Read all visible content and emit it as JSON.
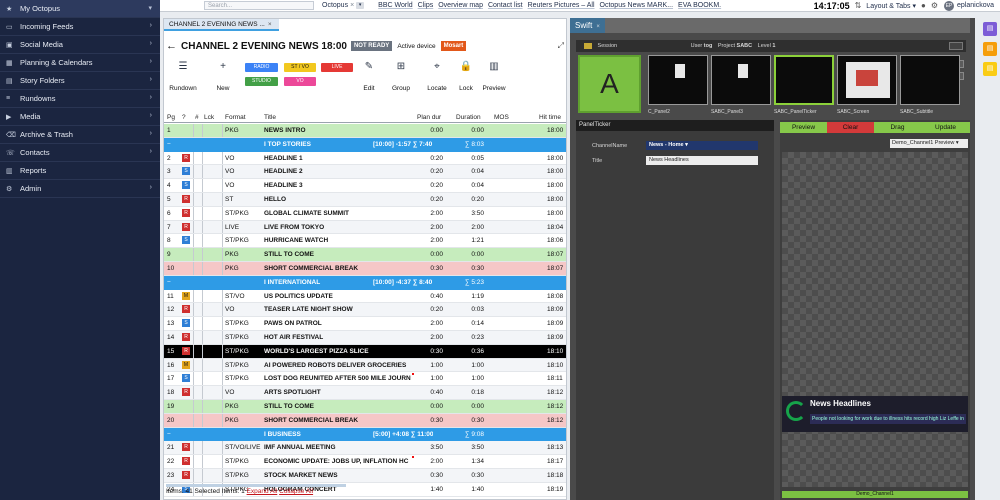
{
  "topbar": {
    "search_placeholder": "Search...",
    "octopus_label": "Octopus",
    "octopus_x": "×",
    "octopus_caret": "▾",
    "bookmarks": [
      "BBC World",
      "Clips",
      "Overview map",
      "Contact list",
      "Reuters Pictures – All",
      "Octopus News MARK...",
      "EVA BOOKM."
    ],
    "clock": "14:17:05",
    "layout_label": "Layout & Tabs",
    "avatar_initials": "EP",
    "user_name": "eplanickova"
  },
  "sidebar": {
    "items": [
      {
        "label": "My Octopus",
        "icon": "★",
        "chev": "▾"
      },
      {
        "label": "Incoming Feeds",
        "icon": "▭",
        "chev": "›"
      },
      {
        "label": "Social Media",
        "icon": "▣",
        "chev": "›"
      },
      {
        "label": "Planning & Calendars",
        "icon": "▦",
        "chev": "›"
      },
      {
        "label": "Story Folders",
        "icon": "▤",
        "chev": "›"
      },
      {
        "label": "Rundowns",
        "icon": "≡",
        "chev": "›"
      },
      {
        "label": "Media",
        "icon": "▶",
        "chev": "›"
      },
      {
        "label": "Archive & Trash",
        "icon": "⌫",
        "chev": "›"
      },
      {
        "label": "Contacts",
        "icon": "☏",
        "chev": "›"
      },
      {
        "label": "Reports",
        "icon": "▥",
        "chev": ""
      },
      {
        "label": "Admin",
        "icon": "⚙",
        "chev": "›"
      }
    ]
  },
  "story_tab": {
    "label": "CHANNEL 2  EVENING NEWS ...",
    "close": "×"
  },
  "rundown": {
    "back": "←",
    "title": "CHANNEL 2  EVENING NEWS 18:00",
    "status": "NOT READY",
    "active_device": "Active device",
    "mosart": "Mosart",
    "popout": "⤢"
  },
  "toolbar": {
    "rundown_label": "Rundown",
    "rundown_icon": "☰",
    "new_label": "New",
    "new_icon": "+",
    "edit_label": "Edit",
    "edit_icon": "✎",
    "group_label": "Group",
    "group_icon": "⊞",
    "locate_label": "Locate",
    "locate_icon": "⌖",
    "lock_label": "Lock",
    "lock_icon": "🔒",
    "preview_label": "Preview",
    "preview_icon": "▥",
    "chips": {
      "radio": "RADIO",
      "stvo": "ST / VO",
      "live": "LIVE",
      "studio": "STUDIO",
      "vo": "VO"
    }
  },
  "columns": {
    "pg": "Pg",
    "q": "?",
    "num": "#",
    "lck": "Lck",
    "format": "Format",
    "title": "Title",
    "plan": "Plan dur",
    "duration": "Duration",
    "mos": "MOS",
    "hit": "Hit time"
  },
  "rows": [
    {
      "pg": "1",
      "tag": "",
      "format": "PKG",
      "title": "NEWS INTRO",
      "plan": "0:00",
      "dur": "0:00",
      "hit": "18:00",
      "kind": "green"
    },
    {
      "pg": "",
      "tag": "",
      "format": "",
      "title": "I TOP STORIES",
      "extra": "[10:00] -1:57   ∑ 7:40",
      "plan": "",
      "dur": "∑ 8:03",
      "hit": "",
      "kind": "header"
    },
    {
      "pg": "2",
      "tag": "R",
      "format": "VO",
      "title": "HEADLINE 1",
      "plan": "0:20",
      "dur": "0:05",
      "hit": "18:00",
      "kind": ""
    },
    {
      "pg": "3",
      "tag": "S",
      "format": "VO",
      "title": "HEADLINE 2",
      "plan": "0:20",
      "dur": "0:04",
      "hit": "18:00",
      "kind": ""
    },
    {
      "pg": "4",
      "tag": "S",
      "format": "VO",
      "title": "HEADLINE 3",
      "plan": "0:20",
      "dur": "0:04",
      "hit": "18:00",
      "kind": ""
    },
    {
      "pg": "5",
      "tag": "R",
      "format": "ST",
      "title": "HELLO",
      "plan": "0:20",
      "dur": "0:20",
      "hit": "18:00",
      "kind": ""
    },
    {
      "pg": "6",
      "tag": "R",
      "format": "ST/PKG",
      "title": "GLOBAL CLIMATE SUMMIT",
      "plan": "2:00",
      "dur": "3:50",
      "hit": "18:00",
      "kind": ""
    },
    {
      "pg": "7",
      "tag": "R",
      "format": "LIVE",
      "title": "LIVE FROM TOKYO",
      "plan": "2:00",
      "dur": "2:00",
      "hit": "18:04",
      "kind": ""
    },
    {
      "pg": "8",
      "tag": "S",
      "format": "ST/PKG",
      "title": "HURRICANE WATCH",
      "plan": "2:00",
      "dur": "1:21",
      "hit": "18:06",
      "kind": ""
    },
    {
      "pg": "9",
      "tag": "",
      "format": "PKG",
      "title": "STILL TO COME",
      "plan": "0:00",
      "dur": "0:00",
      "hit": "18:07",
      "kind": "green"
    },
    {
      "pg": "10",
      "tag": "",
      "format": "PKG",
      "title": "SHORT COMMERCIAL BREAK",
      "plan": "0:30",
      "dur": "0:30",
      "hit": "18:07",
      "kind": "pink"
    },
    {
      "pg": "",
      "tag": "",
      "format": "",
      "title": "I INTERNATIONAL",
      "extra": "[10:00] -4:37   ∑ 8:40",
      "plan": "",
      "dur": "∑ 5:23",
      "hit": "",
      "kind": "header"
    },
    {
      "pg": "11",
      "tag": "M",
      "format": "ST/VO",
      "title": "US POLITICS UPDATE",
      "plan": "0:40",
      "dur": "1:19",
      "hit": "18:08",
      "kind": ""
    },
    {
      "pg": "12",
      "tag": "R",
      "format": "VO",
      "title": "TEASER LATE NIGHT SHOW",
      "plan": "0:20",
      "dur": "0:03",
      "hit": "18:09",
      "kind": ""
    },
    {
      "pg": "13",
      "tag": "S",
      "format": "ST/PKG",
      "title": "PAWS ON PATROL",
      "plan": "2:00",
      "dur": "0:14",
      "hit": "18:09",
      "kind": ""
    },
    {
      "pg": "14",
      "tag": "R",
      "format": "ST/PKG",
      "title": "HOT AIR FESTIVAL",
      "plan": "2:00",
      "dur": "0:23",
      "hit": "18:09",
      "kind": ""
    },
    {
      "pg": "15",
      "tag": "R",
      "format": "ST/PKG",
      "title": "WORLD'S LARGEST PIZZA SLICE",
      "plan": "0:30",
      "dur": "0:36",
      "hit": "18:10",
      "kind": "black"
    },
    {
      "pg": "16",
      "tag": "M",
      "format": "ST/PKG",
      "title": "AI POWERED ROBOTS DELIVER GROCERIES",
      "plan": "1:00",
      "dur": "1:00",
      "hit": "18:10",
      "kind": ""
    },
    {
      "pg": "17",
      "tag": "S",
      "format": "ST/PKG",
      "title": "LOST DOG REUNITED AFTER 500 MILE JOURN",
      "plan": "1:00",
      "dur": "1:00",
      "hit": "18:11",
      "kind": "",
      "red": true
    },
    {
      "pg": "18",
      "tag": "R",
      "format": "VO",
      "title": "ARTS SPOTLIGHT",
      "plan": "0:40",
      "dur": "0:18",
      "hit": "18:12",
      "kind": ""
    },
    {
      "pg": "19",
      "tag": "",
      "format": "PKG",
      "title": "STILL TO COME",
      "plan": "0:00",
      "dur": "0:00",
      "hit": "18:12",
      "kind": "green"
    },
    {
      "pg": "20",
      "tag": "",
      "format": "PKG",
      "title": "SHORT COMMERCIAL BREAK",
      "plan": "0:30",
      "dur": "0:30",
      "hit": "18:12",
      "kind": "pink"
    },
    {
      "pg": "",
      "tag": "",
      "format": "",
      "title": "I BUSINESS",
      "extra": "[5:00] +4:08   ∑ 11:00",
      "plan": "",
      "dur": "∑ 9:08",
      "hit": "",
      "kind": "header"
    },
    {
      "pg": "21",
      "tag": "R",
      "format": "ST/VO/LIVE",
      "title": "IMF ANNUAL MEETING",
      "plan": "3:50",
      "dur": "3:50",
      "hit": "18:13",
      "kind": ""
    },
    {
      "pg": "22",
      "tag": "R",
      "format": "ST/PKG",
      "title": "ECONOMIC UPDATE: JOBS UP, INFLATION HC",
      "plan": "2:00",
      "dur": "1:34",
      "hit": "18:17",
      "kind": "",
      "red": true
    },
    {
      "pg": "23",
      "tag": "R",
      "format": "ST/PKG",
      "title": "STOCK MARKET NEWS",
      "plan": "0:30",
      "dur": "0:30",
      "hit": "18:18",
      "kind": ""
    },
    {
      "pg": "24",
      "tag": "S",
      "format": "ST/PKG",
      "title": "HOLOGRAM CONCERT",
      "plan": "1:40",
      "dur": "1:40",
      "hit": "18:19",
      "kind": ""
    }
  ],
  "footer": {
    "text": "Items: 41 Selected Items: 1",
    "expand": "Expand All",
    "collapse": "Collapse All"
  },
  "swift": {
    "tab": "Swift",
    "tab_close": "×",
    "session_label": "Session",
    "user_label": "User",
    "user_value": "tog",
    "project_label": "Project",
    "project_value": "SABC",
    "level_label": "Level",
    "level_value": "1",
    "big_letter": "A",
    "thumbs": [
      "C_Panel2",
      "SABC_Panel3",
      "SABC_PanelTicker",
      "SABC_Screen",
      "SABC_Subtitle"
    ],
    "panel_title": "PanelTicker",
    "channel_label": "ChannelName",
    "channel_value": "News - Home ▾",
    "title_label": "Title",
    "title_value": "News Headlines",
    "btn_preview": "Preview",
    "btn_clear": "Clear",
    "btn_drag": "Drag",
    "btn_update": "Update",
    "preview_select": "Demo_Channel1 Preview ▾",
    "ticker_heading": "News Headlines",
    "ticker_sub": "People not looking for work due to illness hits record high     Liz Leffe in",
    "bottom_label": "Demo_Channel1"
  },
  "colors": {
    "green_row": "#c6ecbd",
    "pink_row": "#f5c7c7",
    "header_row": "#2e9be6",
    "black_row": "#000000",
    "tag_R": "#cf2f2f",
    "tag_S": "#2f7fd6",
    "tag_M": "#e3a51b"
  }
}
